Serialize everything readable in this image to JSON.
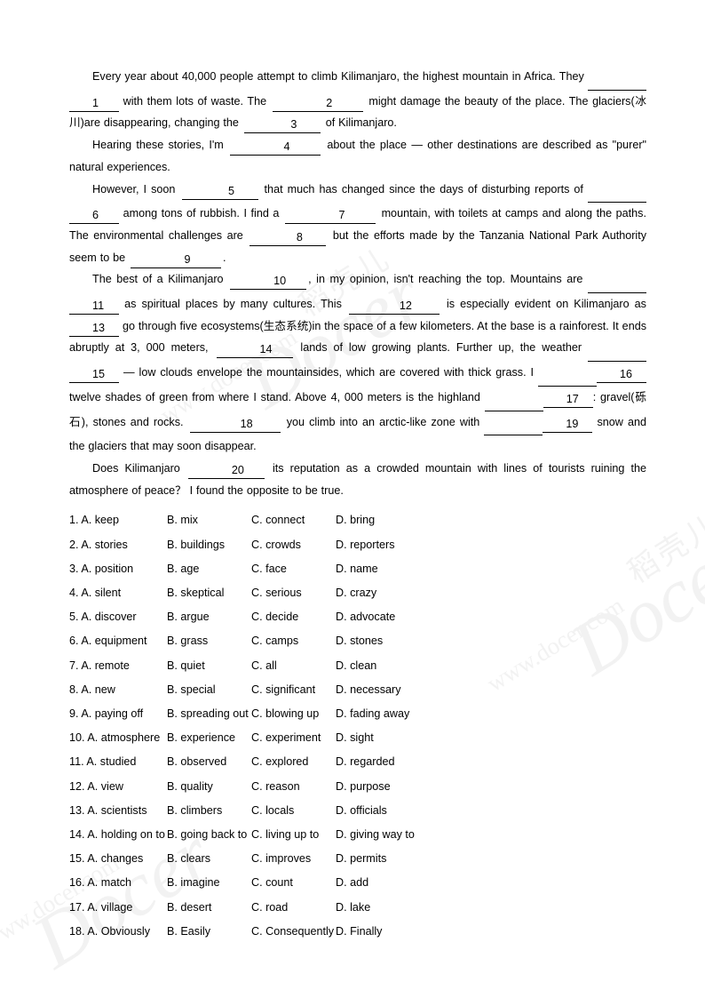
{
  "document": {
    "title": "Kilimanjaro Cloze Test",
    "watermark": {
      "chinese": "稻壳儿",
      "brand": "Docer",
      "url": "www.docer.com"
    }
  },
  "passage": {
    "paragraphs": [
      {
        "id": "p1",
        "segments": [
          {
            "type": "text",
            "value": "Every year about 40,000 people attempt to climb Kilimanjaro, the highest mountain in Africa. They "
          },
          {
            "type": "blank-tail",
            "value": ""
          },
          {
            "type": "blank-head",
            "value": "1"
          },
          {
            "type": "text",
            "value": " with them lots of waste. The "
          },
          {
            "type": "blank",
            "value": "2"
          },
          {
            "type": "text",
            "value": " might damage the beauty of the place. The glaciers(冰川)are disappearing, changing the "
          },
          {
            "type": "blank",
            "value": "3"
          },
          {
            "type": "text",
            "value": " of Kilimanjaro."
          }
        ]
      },
      {
        "id": "p2",
        "segments": [
          {
            "type": "text",
            "value": "Hearing these stories, I'm "
          },
          {
            "type": "blank",
            "value": "4"
          },
          {
            "type": "text",
            "value": " about the place — other destinations are described as \"purer\" natural experiences."
          }
        ]
      },
      {
        "id": "p3",
        "segments": [
          {
            "type": "text",
            "value": "However, I soon "
          },
          {
            "type": "blank",
            "value": "5"
          },
          {
            "type": "text",
            "value": " that much has changed since the days of disturbing reports of "
          },
          {
            "type": "blank-tail",
            "value": ""
          },
          {
            "type": "blank-head",
            "value": "6"
          },
          {
            "type": "text",
            "value": " among tons of rubbish. I find a "
          },
          {
            "type": "blank",
            "value": "7"
          },
          {
            "type": "text",
            "value": " mountain, with toilets at camps and along the paths. The environmental challenges are "
          },
          {
            "type": "blank",
            "value": "8"
          },
          {
            "type": "text",
            "value": " but the efforts made by the Tanzania National Park Authority seem to be "
          },
          {
            "type": "blank",
            "value": "9"
          },
          {
            "type": "text",
            "value": "."
          }
        ]
      },
      {
        "id": "p4",
        "segments": [
          {
            "type": "text",
            "value": "The best of a Kilimanjaro "
          },
          {
            "type": "blank",
            "value": "10"
          },
          {
            "type": "text",
            "value": ", in my opinion, isn't reaching the top. Mountains are "
          },
          {
            "type": "blank-tail",
            "value": ""
          },
          {
            "type": "blank-head",
            "value": "11"
          },
          {
            "type": "text",
            "value": " as spiritual places by many cultures. This "
          },
          {
            "type": "blank",
            "value": "12"
          },
          {
            "type": "text",
            "value": " is especially evident on Kilimanjaro as "
          },
          {
            "type": "blank-head",
            "value": "13"
          },
          {
            "type": "text",
            "value": " go through five ecosystems(生态系统)in the space of a few kilometers. At the base is a rainforest. It ends abruptly at 3, 000 meters, "
          },
          {
            "type": "blank",
            "value": "14"
          },
          {
            "type": "text",
            "value": " lands of low growing plants. Further up, the weather "
          },
          {
            "type": "blank-tail",
            "value": ""
          },
          {
            "type": "blank-head",
            "value": "15"
          },
          {
            "type": "text",
            "value": " — low clouds envelope the mountainsides, which are covered with thick grass. I "
          },
          {
            "type": "blank-tail",
            "value": ""
          },
          {
            "type": "blank-head",
            "value": "16"
          },
          {
            "type": "text",
            "value": " twelve shades of green from where I stand. Above 4, 000 meters is the highland "
          },
          {
            "type": "blank-tail",
            "value": ""
          },
          {
            "type": "blank-head",
            "value": "17"
          },
          {
            "type": "text",
            "value": ": gravel(砾石), stones and rocks. "
          },
          {
            "type": "blank",
            "value": "18"
          },
          {
            "type": "text",
            "value": " you climb into an arctic-like zone with "
          },
          {
            "type": "blank-tail",
            "value": ""
          },
          {
            "type": "blank-head",
            "value": "19"
          },
          {
            "type": "text",
            "value": " snow and the glaciers that may soon disappear."
          }
        ]
      },
      {
        "id": "p5",
        "segments": [
          {
            "type": "text",
            "value": "Does Kilimanjaro "
          },
          {
            "type": "blank",
            "value": "20"
          },
          {
            "type": "text",
            "value": " its reputation as a crowded mountain with lines of tourists ruining the atmosphere of peace？ I found the opposite to be true."
          }
        ]
      }
    ]
  },
  "questions": [
    {
      "num": "1.",
      "a": "A. keep",
      "b": "B. mix",
      "c": "C. connect",
      "d": "D. bring"
    },
    {
      "num": "2.",
      "a": "A. stories",
      "b": "B. buildings",
      "c": "C. crowds",
      "d": "D. reporters"
    },
    {
      "num": "3.",
      "a": "A. position",
      "b": "B. age",
      "c": "C. face",
      "d": "D. name"
    },
    {
      "num": "4.",
      "a": "A. silent",
      "b": "B. skeptical",
      "c": "C. serious",
      "d": "D. crazy"
    },
    {
      "num": "5.",
      "a": "A. discover",
      "b": "B. argue",
      "c": "C. decide",
      "d": "D. advocate"
    },
    {
      "num": "6.",
      "a": "A. equipment",
      "b": "B. grass",
      "c": "C. camps",
      "d": "D. stones"
    },
    {
      "num": "7.",
      "a": "A. remote",
      "b": "B. quiet",
      "c": "C. all",
      "d": "D. clean"
    },
    {
      "num": "8.",
      "a": "A. new",
      "b": "B. special",
      "c": "C. significant",
      "d": "D. necessary"
    },
    {
      "num": "9.",
      "a": "A. paying off",
      "b": "B. spreading out",
      "c": "C. blowing up",
      "d": "D. fading away"
    },
    {
      "num": "10.",
      "a": "A. atmosphere",
      "b": "B. experience",
      "c": "C. experiment",
      "d": "D. sight"
    },
    {
      "num": "11.",
      "a": "A. studied",
      "b": "B. observed",
      "c": "C. explored",
      "d": "D. regarded"
    },
    {
      "num": "12.",
      "a": "A. view",
      "b": "B. quality",
      "c": "C. reason",
      "d": "D. purpose"
    },
    {
      "num": "13.",
      "a": "A. scientists",
      "b": "B. climbers",
      "c": "C. locals",
      "d": "D. officials"
    },
    {
      "num": "14.",
      "a": "A. holding on to",
      "b": "B. going back to",
      "c": "C. living up to",
      "d": "D. giving way to"
    },
    {
      "num": "15.",
      "a": "A. changes",
      "b": "B. clears",
      "c": "C. improves",
      "d": "D. permits"
    },
    {
      "num": "16.",
      "a": "A. match",
      "b": "B. imagine",
      "c": "C. count",
      "d": "D. add"
    },
    {
      "num": "17.",
      "a": "A. village",
      "b": "B. desert",
      "c": "C. road",
      "d": "D. lake"
    },
    {
      "num": "18.",
      "a": "A. Obviously",
      "b": "B. Easily",
      "c": "C. Consequently",
      "d": "D. Finally"
    }
  ]
}
